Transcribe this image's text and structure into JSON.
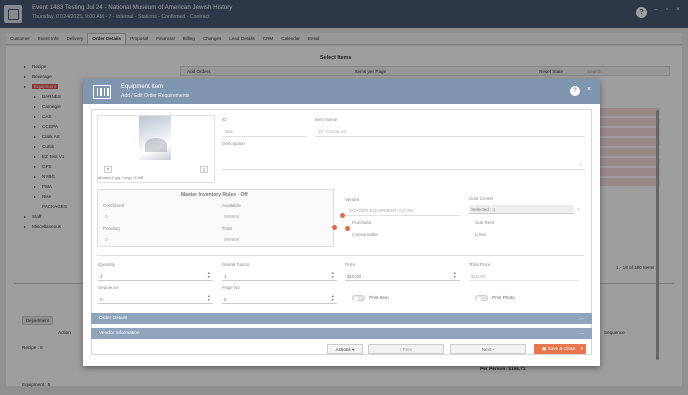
{
  "app": {
    "title": "Event 1483 Testing Jul 24 - National Museum of American Jewish History",
    "subtitle": "Thursday, 07/24/2025, 9:00 AM - 7 - Internal - Stations - Confirmed - Contract"
  },
  "tabs": [
    "Customer",
    "Event Info",
    "Delivery",
    "Order Details",
    "Proposal",
    "Financial",
    "Billing",
    "Changes",
    "Lead Details",
    "CRM",
    "Calendar",
    "Email"
  ],
  "background": {
    "section_title": "Select Items",
    "add_orders": "Add Orders",
    "items_per_page": "Items per Page",
    "reset_state": "Reset State",
    "search_placeholder": "Search",
    "tree": [
      "Recipe",
      "Beverage",
      "Equipment",
      "BARNES",
      "Carnegie",
      "CAS",
      "CCGPA",
      "Clark Art",
      "Curtis",
      "EZ Test V1",
      "GFS",
      "NYBG",
      "PMA",
      "Rise",
      "PACKAGES",
      "Staff",
      "Miscellaneous"
    ],
    "pager": "1 - 18 of 180 Items",
    "department_chip": "Department",
    "action_label": "Action",
    "recipe_label": "Recipe : 8",
    "equipment_label": "Equipment : 5",
    "sequence_label": "Sequence",
    "per_person": "Per Person: $166.71"
  },
  "modal": {
    "title": "Equipment Item",
    "subtitle": "Add / Edit Order Requirements",
    "id_label": "ID",
    "id_value": "855",
    "item_name_label": "Item Name",
    "item_name_value": "10\" Cocoa Ice",
    "description_label": "Description",
    "image_note": "Allowed (*.jpg, *.png) <5 MB",
    "inventory": {
      "title": "Master Inventory Rules - Off",
      "confirmed_label": "Confirmed",
      "confirmed_value": "0",
      "available_label": "Available",
      "available_value": "999999",
      "pending_label": "Pending",
      "pending_value": "0",
      "total_label": "Total",
      "total_value": "999999"
    },
    "vendor_label": "Vendor",
    "vendor_value": "KRAGER EQUIPMENT CO INC",
    "purchase_label": "Purchase",
    "consumable_label": "Consumable",
    "cost_center_label": "Cost Center",
    "cost_center_value": "Selected : 1",
    "sub_rent_label": "Sub Rent",
    "linen_label": "Linen",
    "quantity_label": "Quantity",
    "quantity_value": "4",
    "rental_factor_label": "Rental Factor",
    "rental_factor_value": "1",
    "price_label": "Price",
    "price_value": "$15.00",
    "total_price_label": "Total Price",
    "total_price_value": "$15.00",
    "sequence_label": "Sequence",
    "sequence_value": "0",
    "page_no_label": "Page No",
    "page_no_value": "0",
    "print_item_label": "Print Item",
    "print_photo_label": "Print Photo",
    "order_details_label": "Order Details",
    "vendor_info_label": "Vendor Information",
    "actions_label": "Actions",
    "prev_label": "Prev",
    "next_label": "Next",
    "save_close_label": "Save & Close"
  },
  "colors": {
    "titlebar": "#4a5a73",
    "modal_header": "#8096b0",
    "accordion": "#8fa4bd",
    "primary_action": "#e8764e",
    "highlight": "#d9534f"
  }
}
